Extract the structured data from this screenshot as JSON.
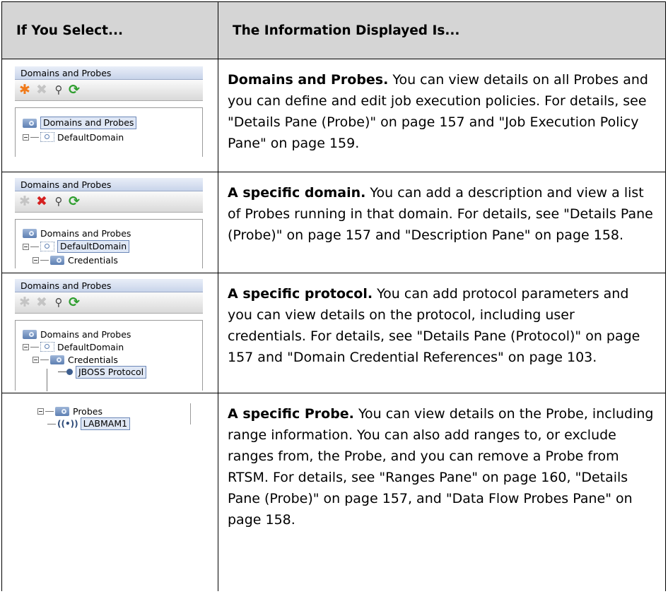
{
  "header": {
    "col1": "If You Select...",
    "col2": "The Information Displayed Is..."
  },
  "rows": [
    {
      "shot": {
        "panel_title": "Domains and Probes",
        "toolbar": [
          "add-star-icon",
          "delete-x-icon",
          "search-icon",
          "refresh-icon"
        ],
        "tree": [
          "Domains and Probes",
          "DefaultDomain"
        ],
        "selected": "Domains and Probes"
      },
      "bold": "Domains and Probes.",
      "text": " You can view details on all Probes and you can define and edit job execution policies. For details, see \"Details Pane (Probe)\" on page 157 and \"Job Execution Policy Pane\" on page 159."
    },
    {
      "shot": {
        "panel_title": "Domains and Probes",
        "toolbar": [
          "add-star-icon",
          "delete-x-icon",
          "search-icon",
          "refresh-icon"
        ],
        "tree": [
          "Domains and Probes",
          "DefaultDomain",
          "Credentials"
        ],
        "selected": "DefaultDomain"
      },
      "bold": "A specific domain.",
      "text": " You can add a description and view a list of Probes running in that domain. For details, see \"Details Pane (Probe)\" on page 157 and \"Description Pane\" on page 158."
    },
    {
      "shot": {
        "panel_title": "Domains and Probes",
        "toolbar": [
          "add-star-icon",
          "delete-x-icon",
          "search-icon",
          "refresh-icon"
        ],
        "tree": [
          "Domains and Probes",
          "DefaultDomain",
          "Credentials",
          "JBOSS Protocol"
        ],
        "selected": "JBOSS Protocol"
      },
      "bold": "A specific protocol.",
      "text": " You can add protocol parameters and you can view details on the protocol, including user credentials. For details, see \"Details Pane (Protocol)\" on page 157 and \"Domain Credential References\" on page 103."
    },
    {
      "shot": {
        "tree": [
          "Probes",
          "LABMAM1"
        ],
        "selected": "LABMAM1"
      },
      "bold": "A specific Probe.",
      "text": " You can view details on the Probe, including range information. You can also add ranges to, or exclude ranges from, the Probe, and you can remove a Probe from RTSM. For details, see \"Ranges Pane\" on page 160, \"Details Pane (Probe)\" on page 157, and \"Data Flow Probes Pane\" on page 158."
    }
  ],
  "colors": {
    "header_bg": "#d5d5d5",
    "star_orange": "#f07a1a",
    "delete_red": "#d52020",
    "refresh_green": "#2f9e2f",
    "disabled_gray": "#c4c4c4",
    "selection_bg": "#dfe7f5"
  }
}
